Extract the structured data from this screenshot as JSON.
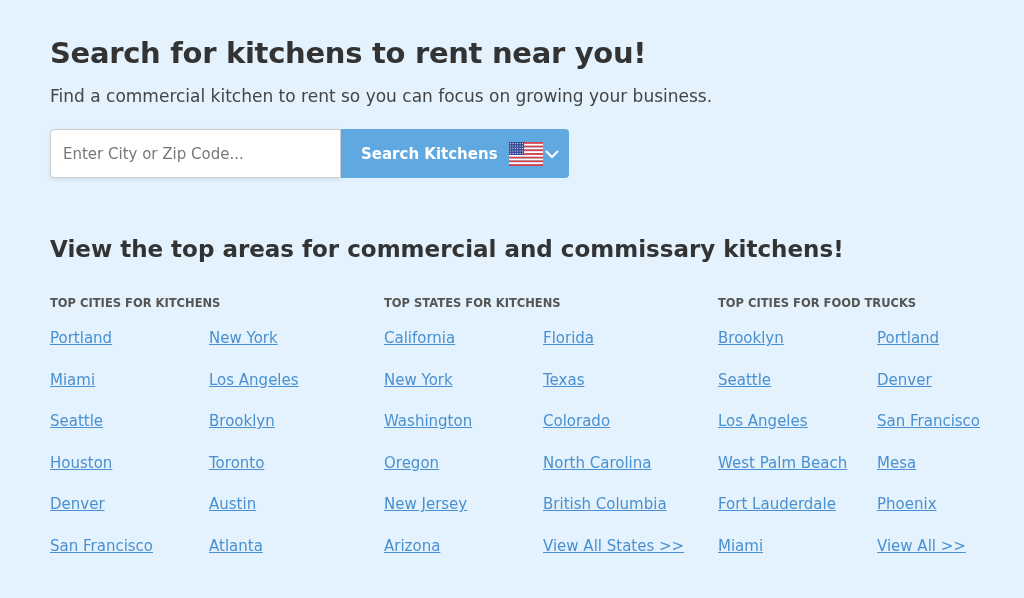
{
  "hero": {
    "title": "Search for kitchens to rent near you!",
    "subtitle": "Find a commercial kitchen to rent so you can focus on growing your business."
  },
  "search": {
    "placeholder": "Enter City or Zip Code...",
    "button": "Search Kitchens"
  },
  "areas": {
    "title": "View the top areas for commercial and commissary kitchens!",
    "groups": [
      {
        "heading": "TOP CITIES FOR KITCHENS",
        "links": [
          "Portland",
          "New York",
          "Miami",
          "Los Angeles",
          "Seattle",
          "Brooklyn",
          "Houston",
          "Toronto",
          "Denver",
          "Austin",
          "San Francisco",
          "Atlanta"
        ]
      },
      {
        "heading": "TOP STATES FOR KITCHENS",
        "links": [
          "California",
          "Florida",
          "New York",
          "Texas",
          "Washington",
          "Colorado",
          "Oregon",
          "North Carolina",
          "New Jersey",
          "British Columbia",
          "Arizona",
          "View All States >>"
        ]
      },
      {
        "heading": "TOP CITIES FOR FOOD TRUCKS",
        "links": [
          "Brooklyn",
          "Portland",
          "Seattle",
          "Denver",
          "Los Angeles",
          "San Francisco",
          "West Palm Beach",
          "Mesa",
          "Fort Lauderdale",
          "Phoenix",
          "Miami",
          "View All >>"
        ]
      }
    ]
  }
}
